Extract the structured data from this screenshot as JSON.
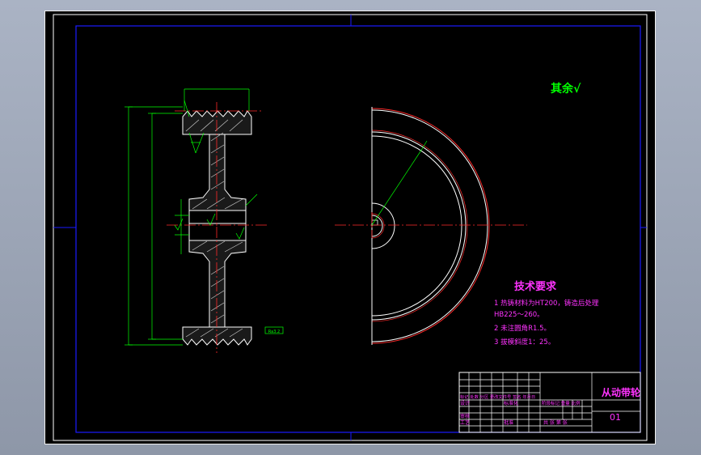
{
  "colors": {
    "background": "#000000",
    "frame": "#ffffff",
    "border": "#1a1aff",
    "geometry": "#ffffff",
    "dimension": "#00ff00",
    "centerline": "#ff2a2a",
    "hatch": "#c8c8c8",
    "text": "#ff33ff",
    "titleblock": "#ffffff"
  },
  "drawing": {
    "surface_finish_note": "其余√",
    "section_note": "Ra3.2",
    "tech_requirements": {
      "title": "技术要求",
      "items": [
        "1 热铸材料为HT200，铸造后处理",
        "HB225～260。",
        "2 未注圆角R1.5。",
        "3 拔模斜度1：25。"
      ]
    }
  },
  "title_block": {
    "part_name": "从动带轮",
    "drawing_number": "01",
    "revision_row_text": "标记 处数 分区 更改文件号 签名 年月日",
    "design_label": "设计",
    "standardization_label": "标准化",
    "review_label": "审核",
    "process_label": "工艺",
    "approve_label": "批准",
    "stage_labels": "阶段标记 重量 比例",
    "sheet_labels": "共 张 第 张"
  }
}
